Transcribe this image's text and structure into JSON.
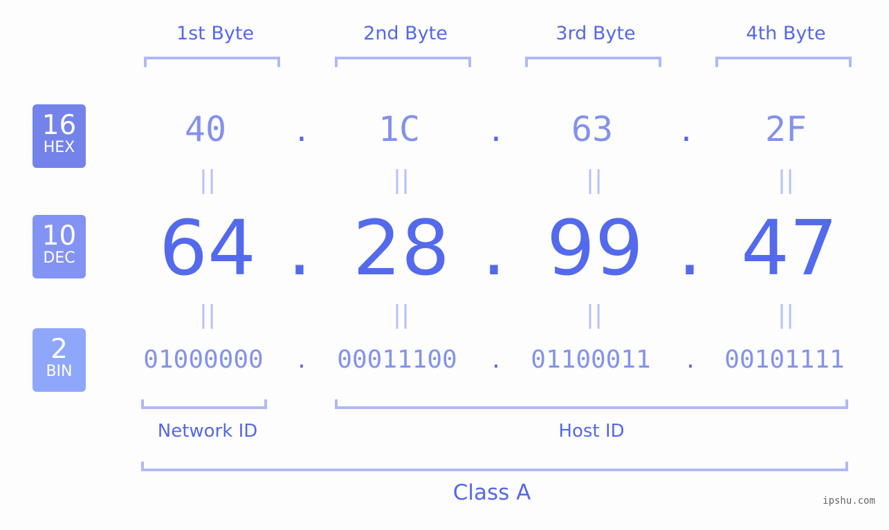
{
  "bytes": [
    {
      "label": "1st Byte",
      "hex": "40",
      "dec": "64",
      "bin": "01000000"
    },
    {
      "label": "2nd Byte",
      "hex": "1C",
      "dec": "28",
      "bin": "00011100"
    },
    {
      "label": "3rd Byte",
      "hex": "63",
      "dec": "99",
      "bin": "01100011"
    },
    {
      "label": "4th Byte",
      "hex": "2F",
      "dec": "47",
      "bin": "00101111"
    }
  ],
  "separator": ".",
  "equals": "||",
  "badges": {
    "hex": {
      "num": "16",
      "label": "HEX"
    },
    "dec": {
      "num": "10",
      "label": "DEC"
    },
    "bin": {
      "num": "2",
      "label": "BIN"
    }
  },
  "network_id_label": "Network ID",
  "host_id_label": "Host ID",
  "class_label": "Class A",
  "watermark": "ipshu.com",
  "colors": {
    "accent": "#546aec",
    "bracket": "#b0b9f6",
    "hex_badge": "#7483e9",
    "dec_badge": "#8393f3",
    "bin_badge": "#8fa7fb"
  }
}
